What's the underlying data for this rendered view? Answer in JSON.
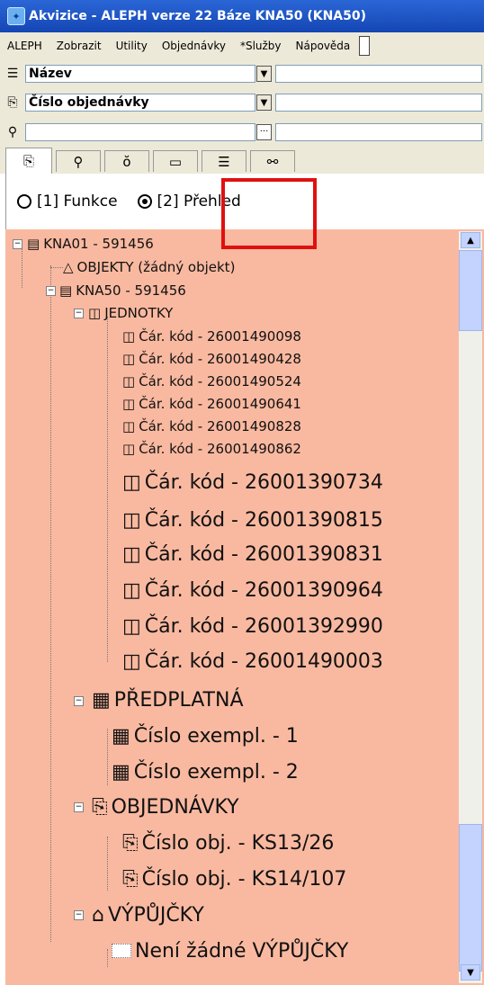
{
  "window": {
    "title": "Akvizice - ALEPH verze 22  Báze KNA50 (KNA50)"
  },
  "menu": [
    "ALEPH",
    "Zobrazit",
    "Utility",
    "Objednávky",
    "*Služby",
    "Nápověda"
  ],
  "search_rows": [
    {
      "icon": "list-icon",
      "combo_value": "Název"
    },
    {
      "icon": "order-icon",
      "combo_value": "Číslo objednávky"
    }
  ],
  "tabs": [
    {
      "icon": "order-icon",
      "glyph": "⎘"
    },
    {
      "icon": "vendor-icon",
      "glyph": "⚲"
    },
    {
      "icon": "basket-icon",
      "glyph": "ŏ"
    },
    {
      "icon": "folder-icon",
      "glyph": "▭"
    },
    {
      "icon": "list-icon",
      "glyph": "☰"
    },
    {
      "icon": "binoculars-icon",
      "glyph": "⚯"
    }
  ],
  "view_mode": {
    "option1": "[1] Funkce",
    "option2": "[2] Přehled",
    "selected": 2
  },
  "tree": {
    "root": "KNA01 - 591456",
    "objekty": "OBJEKTY (žádný objekt)",
    "kna50": "KNA50 - 591456",
    "jednotky": "JEDNOTKY",
    "items_small": [
      "Čár. kód - 26001490098",
      "Čár. kód - 26001490428",
      "Čár. kód - 26001490524",
      "Čár. kód - 26001490641",
      "Čár. kód - 26001490828",
      "Čár. kód - 26001490862"
    ],
    "items_large": [
      "Čár. kód - 26001390734",
      "Čár. kód - 26001390815",
      "Čár. kód - 26001390831",
      "Čár. kód - 26001390964",
      "Čár. kód - 26001392990",
      "Čár. kód - 26001490003"
    ],
    "predplatna": "PŘEDPLATNÁ",
    "exemplare": [
      "Číslo exempl. - 1",
      "Číslo exempl. - 2"
    ],
    "objednavky": "OBJEDNÁVKY",
    "objednavky_items": [
      "Číslo obj. - KS13/26",
      "Číslo obj. - KS14/107"
    ],
    "vypujcky": "VÝPŮJČKY",
    "vypujcky_empty": "Není žádné VÝPŮJČKY"
  },
  "colors": {
    "tree_bg": "#f9b9a0",
    "highlight": "#e01010",
    "titlebar": "#1a4fc0"
  }
}
